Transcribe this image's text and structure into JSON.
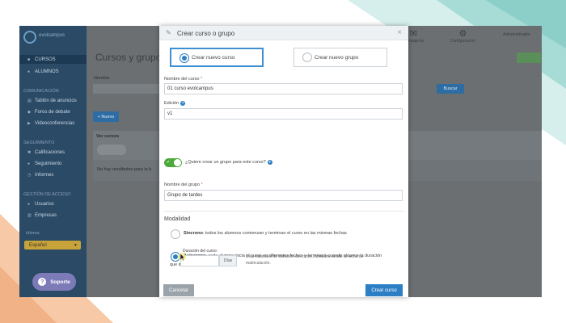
{
  "colors": {
    "sidebar": "#2b4a66",
    "primary": "#2d7fc5",
    "toggle_on": "#4caa3a",
    "support": "#7d7ab8",
    "lang_select": "#c8a33a",
    "required": "#d9534f"
  },
  "sidebar": {
    "items_top": [
      {
        "label": "CURSOS",
        "icon": "book-icon"
      },
      {
        "label": "ALUMNOS",
        "icon": "user-icon"
      }
    ],
    "section_comunicacion": "COMUNICACIÓN",
    "items_comunicacion": [
      {
        "label": "Tablón de anuncios",
        "icon": "board-icon"
      },
      {
        "label": "Foros de debate",
        "icon": "forum-icon"
      },
      {
        "label": "Videoconferencias",
        "icon": "video-icon"
      }
    ],
    "section_seguimiento": "SEGUIMIENTO",
    "items_seguimiento": [
      {
        "label": "Calificaciones",
        "icon": "gear-icon"
      },
      {
        "label": "Seguimiento",
        "icon": "user-icon"
      },
      {
        "label": "Informes",
        "icon": "clock-icon"
      }
    ],
    "section_gestion": "GESTIÓN DE ACCESO",
    "items_gestion": [
      {
        "label": "Usuarios",
        "icon": "user-icon"
      },
      {
        "label": "Empresas",
        "icon": "building-icon"
      }
    ],
    "lang_label": "Idioma",
    "lang_value": "Español"
  },
  "support_label": "Soporte",
  "background": {
    "page_title": "Cursos y grupos",
    "filter_label": "Nombre",
    "search_button": "Buscar",
    "new_button": "+ Nuevo",
    "view_label": "Ver cursos",
    "no_results": "No hay resultados para la b",
    "top_icons": [
      "Mensajería",
      "Configuración"
    ],
    "user_name": "Administrador"
  },
  "modal": {
    "title": "Crear curso o grupo",
    "option_course": "Crear nuevo curso",
    "option_group": "Crear nuevo grupo",
    "course_name_label": "Nombre del curso",
    "course_name_value": "01 curso evolcampus",
    "edition_label": "Edición",
    "edition_value": "v1",
    "toggle_label": "¿Quiere crear un grupo para este curso?",
    "group_name_label": "Nombre del grupo",
    "group_name_value": "Grupo de tardes",
    "modality_title": "Modalidad",
    "sync_bold": "Síncrono",
    "sync_text": ": todos los alumnos comienzan y terminan el curso en las mismas fechas",
    "async_bold": "Asíncrono",
    "async_text_1": ": cada alumno inicia el curso en diferentes fechas y terminará cuando alcance la duración",
    "async_text_2": "que indique a continuación",
    "duration_label": "Duración del curso:",
    "duration_addon": "Días",
    "duration_help": "Días naturales de duración del curso, contados desde la fecha de matriculación.",
    "cancel_button": "Cancelar",
    "create_button": "Crear curso"
  }
}
